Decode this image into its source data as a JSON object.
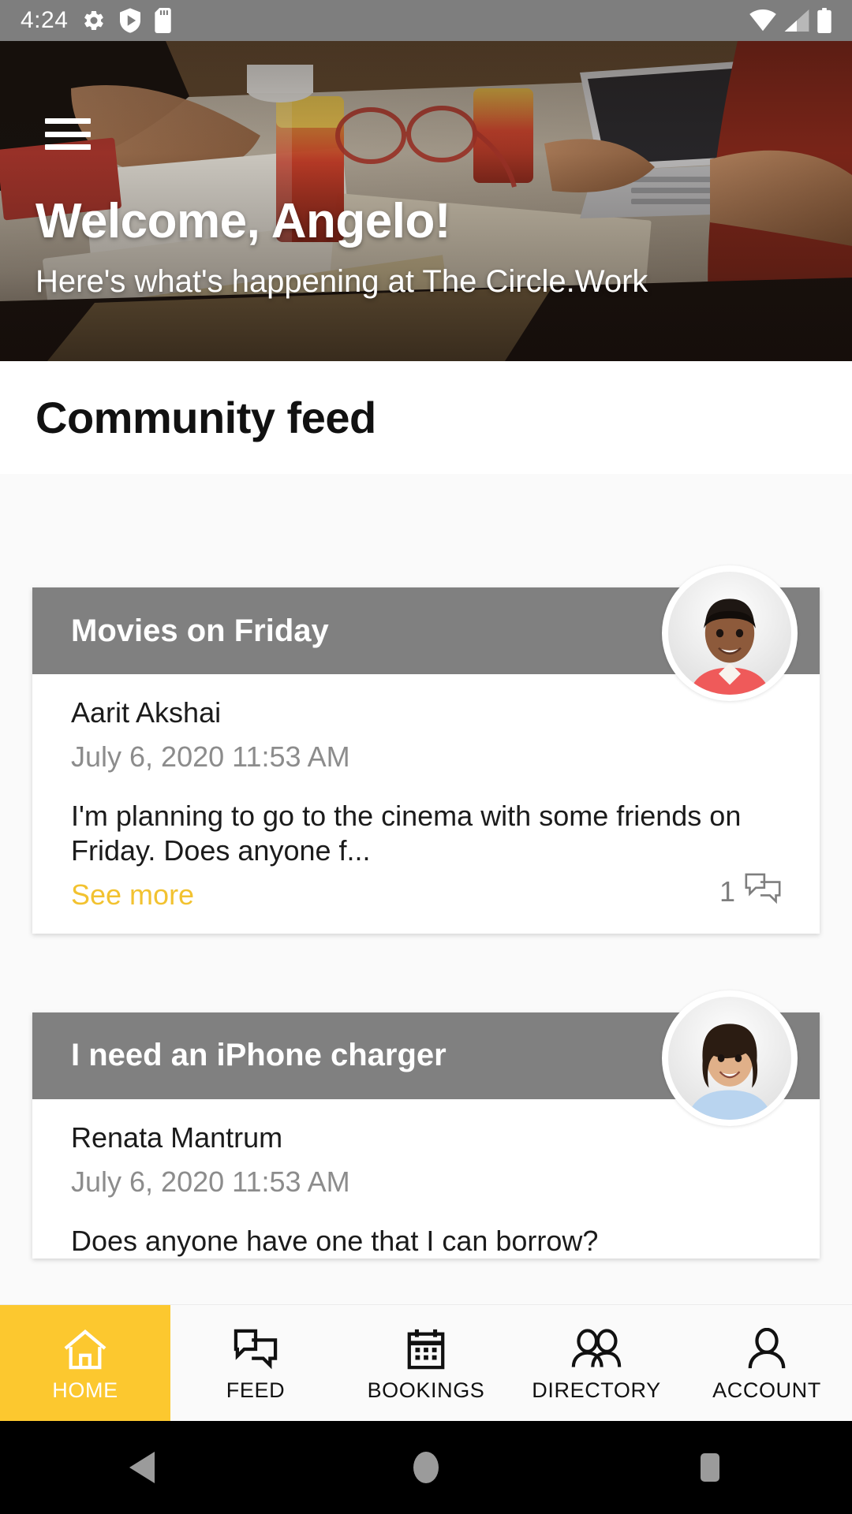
{
  "statusbar": {
    "time": "4:24",
    "left_icons": [
      "gear-icon",
      "shield-play-icon",
      "sd-card-icon"
    ],
    "right_icons": [
      "wifi-icon",
      "cellular-signal-icon",
      "battery-icon"
    ]
  },
  "hero": {
    "menu_icon": "hamburger-menu-icon",
    "title": "Welcome, Angelo!",
    "subtitle": "Here's what's happening at The Circle.Work"
  },
  "section": {
    "title": "Community feed"
  },
  "feed": {
    "posts": [
      {
        "title": "Movies on Friday",
        "author": "Aarit Akshai",
        "timestamp": "July 6, 2020 11:53 AM",
        "body": "I'm planning to go to the cinema with some friends on Friday. Does anyone f...",
        "see_more_label": "See more",
        "comment_count": "1",
        "comment_icon": "comment-bubbles-icon",
        "avatar": "avatar-aarit-akshai"
      },
      {
        "title": "I need an iPhone charger",
        "author": "Renata Mantrum",
        "timestamp": "July 6, 2020 11:53 AM",
        "body": "Does anyone have one that I can borrow?",
        "see_more_label": "",
        "comment_count": "",
        "comment_icon": "comment-bubbles-icon",
        "avatar": "avatar-renata-mantrum"
      }
    ]
  },
  "bottom_nav": {
    "items": [
      {
        "label": "HOME",
        "icon": "home-icon",
        "active": true
      },
      {
        "label": "FEED",
        "icon": "chat-bubbles-icon",
        "active": false
      },
      {
        "label": "BOOKINGS",
        "icon": "calendar-icon",
        "active": false
      },
      {
        "label": "DIRECTORY",
        "icon": "people-icon",
        "active": false
      },
      {
        "label": "ACCOUNT",
        "icon": "person-icon",
        "active": false
      }
    ]
  },
  "system_nav": {
    "back": "back-triangle-icon",
    "home": "home-circle-icon",
    "recents": "recents-square-icon"
  },
  "colors": {
    "accent_yellow": "#fcc82f",
    "see_more_yellow": "#f2c230",
    "card_header_gray": "#808080",
    "statusbar_gray": "#7e7e7e",
    "muted_text": "#8c8c8c"
  }
}
